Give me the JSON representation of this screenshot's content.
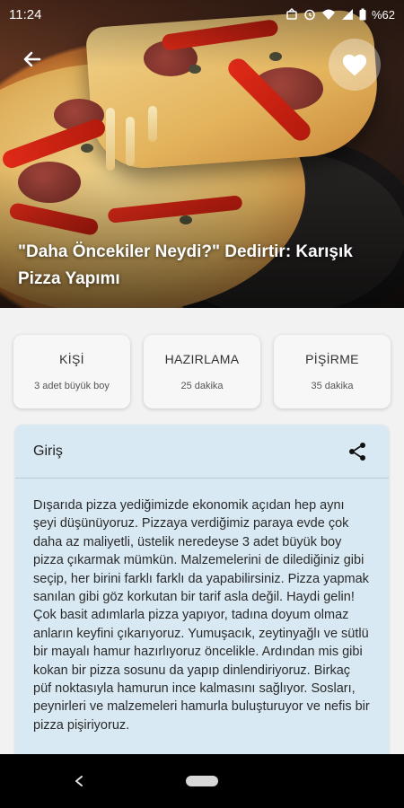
{
  "status_bar": {
    "time": "11:24",
    "battery": "%62"
  },
  "recipe": {
    "title": "\"Daha Öncekiler Neydi?\" Dedirtir: Karışık Pizza Yapımı"
  },
  "info_cards": [
    {
      "title": "KİŞİ",
      "value": "3 adet büyük boy"
    },
    {
      "title": "HAZIRLAMA",
      "value": "25 dakika"
    },
    {
      "title": "PİŞİRME",
      "value": "35 dakika"
    }
  ],
  "intro": {
    "title": "Giriş",
    "text": "Dışarıda pizza yediğimizde ekonomik açıdan hep aynı şeyi düşünüyoruz. Pizzaya verdiğimiz paraya evde çok daha az maliyetli, üstelik neredeyse 3 adet büyük boy pizza çıkarmak mümkün. Malzemelerini de dilediğiniz gibi seçip, her birini farklı farklı da yapabilirsiniz.  Pizza yapmak sanılan gibi göz korkutan bir tarif asla değil. Haydi gelin! Çok basit adımlarla pizza yapıyor, tadına doyum olmaz anların keyfini çıkarıyoruz. Yumuşacık, zeytinyağlı ve sütlü bir mayalı hamur hazırlıyoruz öncelikle. Ardından mis gibi kokan bir pizza sosunu da yapıp dinlendiriyoruz. Birkaç püf noktasıyla hamurun ince kalmasını sağlıyor. Sosları, peynirleri ve malzemeleri hamurla buluşturuyor ve nefis bir pizza pişiriyoruz."
  },
  "icons": {
    "back": "arrow-left-icon",
    "favorite": "heart-icon",
    "share": "share-icon",
    "nav_back": "triangle-back-icon",
    "nav_home": "home-pill-icon"
  },
  "colors": {
    "panel_bg": "#d9e9f3",
    "card_bg": "#f7f7f7",
    "screen_bg": "#f2f2f2"
  }
}
